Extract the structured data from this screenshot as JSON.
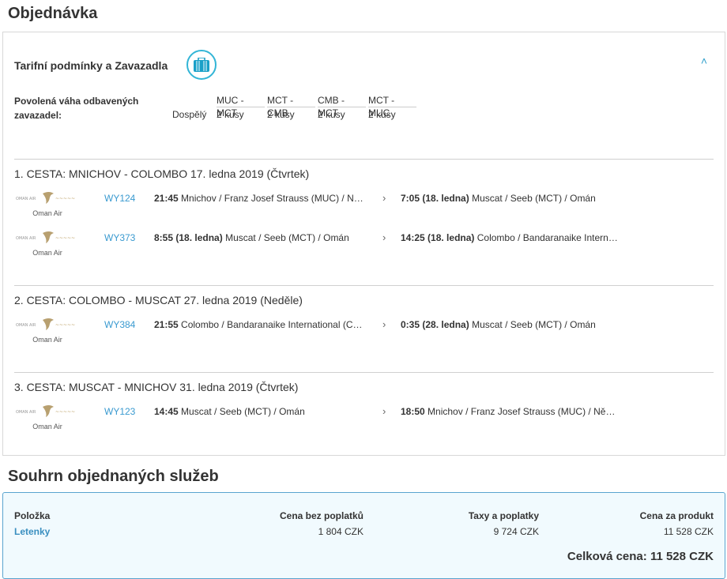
{
  "order": {
    "title": "Objednávka",
    "section_title": "Tarifní podmínky a Zavazadla",
    "baggage": {
      "label": "Povolená váha odbavených zavazadel:",
      "passenger": "Dospělý",
      "routes": [
        {
          "route": "MUC - MCT",
          "value": "2 kusy"
        },
        {
          "route": "MCT - CMB",
          "value": "2 kusy"
        },
        {
          "route": "CMB - MCT",
          "value": "2 kusy"
        },
        {
          "route": "MCT - MUC",
          "value": "2 kusy"
        }
      ]
    },
    "legs": [
      {
        "title": "1. CESTA: MNICHOV - COLOMBO 17. ledna 2019 (Čtvrtek)",
        "flights": [
          {
            "airline": "Oman Air",
            "flight": "WY124",
            "dep_time": "21:45",
            "dep_date": "",
            "dep_place": "Mnichov / Franz Josef Strauss (MUC) / Německo",
            "arr_time": "7:05",
            "arr_date": "(18. ledna)",
            "arr_place": "Muscat / Seeb (MCT) / Omán"
          },
          {
            "airline": "Oman Air",
            "flight": "WY373",
            "dep_time": "8:55",
            "dep_date": "(18. ledna)",
            "dep_place": "Muscat / Seeb (MCT) / Omán",
            "arr_time": "14:25",
            "arr_date": "(18. ledna)",
            "arr_place": "Colombo / Bandaranaike International (CMB) / Srí Lanka"
          }
        ]
      },
      {
        "title": "2. CESTA: COLOMBO - MUSCAT 27. ledna 2019 (Neděle)",
        "flights": [
          {
            "airline": "Oman Air",
            "flight": "WY384",
            "dep_time": "21:55",
            "dep_date": "",
            "dep_place": "Colombo / Bandaranaike International (CMB) / Srí Lanka",
            "arr_time": "0:35",
            "arr_date": "(28. ledna)",
            "arr_place": "Muscat / Seeb (MCT) / Omán"
          }
        ]
      },
      {
        "title": "3. CESTA: MUSCAT - MNICHOV 31. ledna 2019 (Čtvrtek)",
        "flights": [
          {
            "airline": "Oman Air",
            "flight": "WY123",
            "dep_time": "14:45",
            "dep_date": "",
            "dep_place": "Muscat / Seeb (MCT) / Omán",
            "arr_time": "18:50",
            "arr_date": "",
            "arr_place": "Mnichov / Franz Josef Strauss (MUC) / Německo"
          }
        ]
      }
    ]
  },
  "summary": {
    "title": "Souhrn objednaných služeb",
    "headers": {
      "item": "Položka",
      "base": "Cena bez poplatků",
      "taxes": "Taxy a poplatky",
      "total": "Cena za produkt"
    },
    "row": {
      "item": "Letenky",
      "base": "1 804 CZK",
      "taxes": "9 724 CZK",
      "total": "11 528 CZK"
    },
    "grand_total": "Celková cena: 11 528 CZK"
  },
  "colors": {
    "accent": "#33b5d6",
    "link": "#3a9ad0"
  }
}
